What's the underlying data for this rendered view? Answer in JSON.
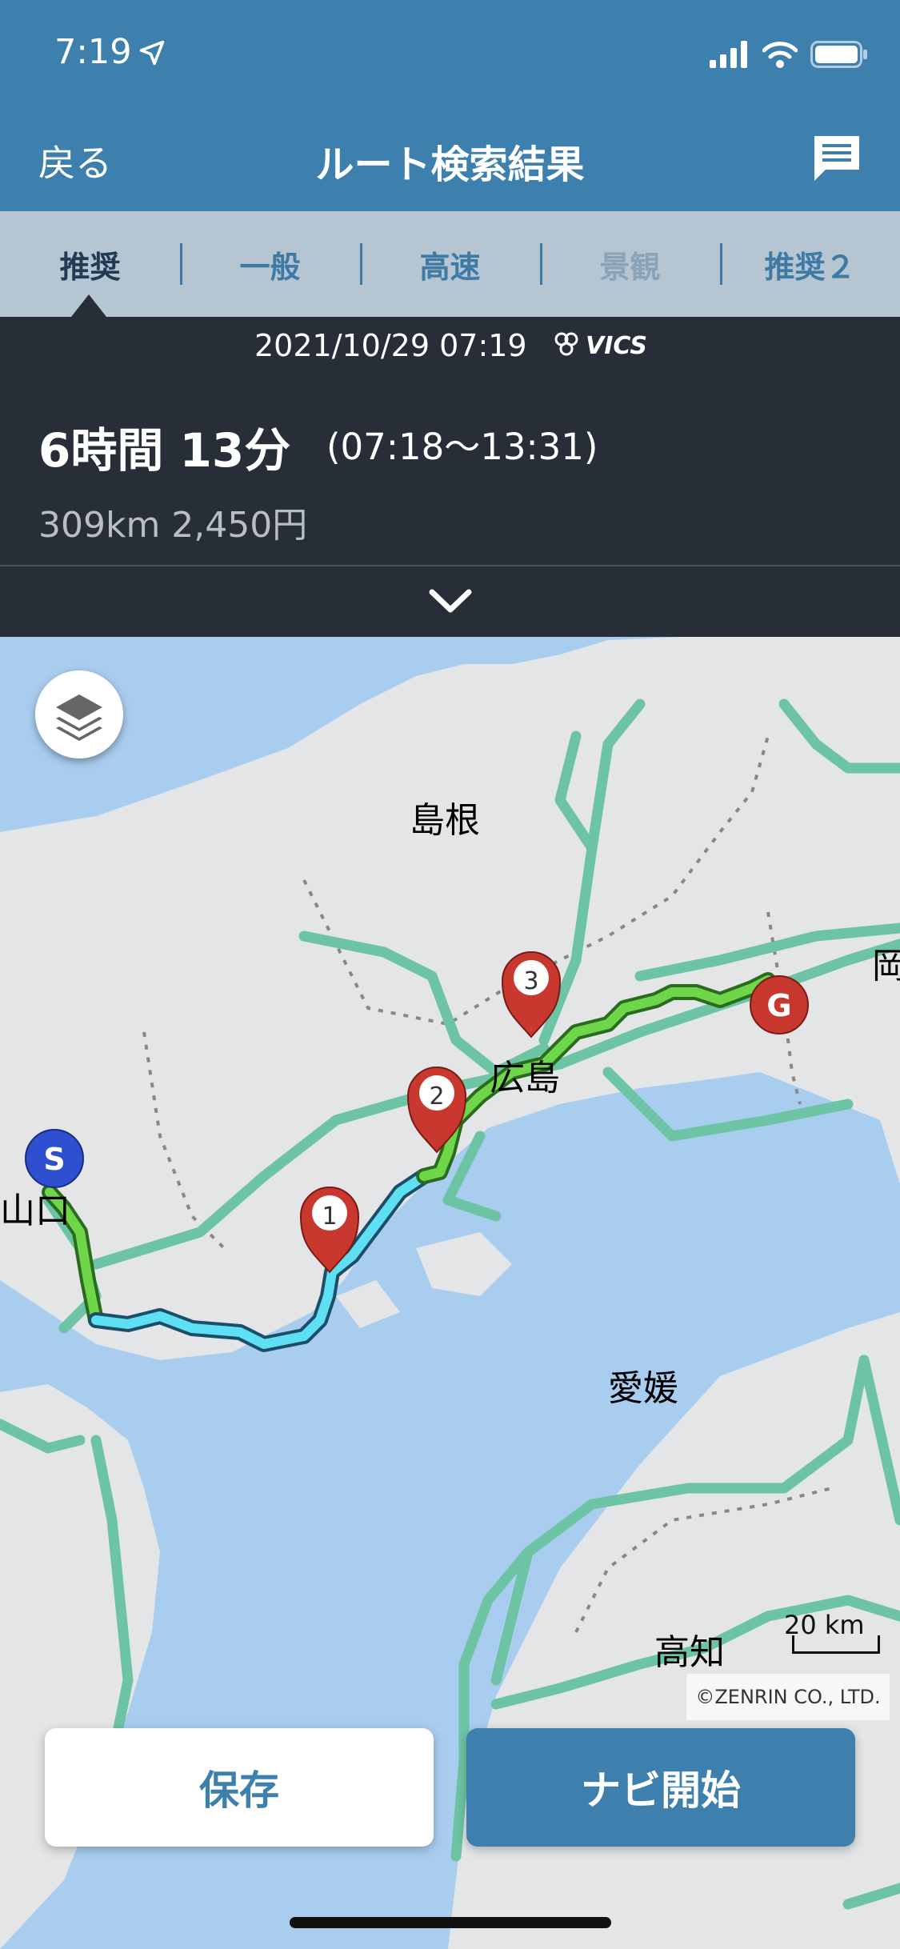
{
  "status_bar": {
    "time": "7:19"
  },
  "header": {
    "back_label": "戻る",
    "title": "ルート検索結果"
  },
  "tabs": [
    {
      "label": "推奨",
      "state": "active"
    },
    {
      "label": "一般",
      "state": "normal"
    },
    {
      "label": "高速",
      "state": "normal"
    },
    {
      "label": "景観",
      "state": "disabled"
    },
    {
      "label": "推奨２",
      "state": "normal"
    }
  ],
  "route_info": {
    "datetime": "2021/10/29 07:19",
    "vics_label": "VICS",
    "duration": "6時間 13分",
    "time_range": "(07:18～13:31)",
    "distance_fare": "309km  2,450円"
  },
  "map": {
    "places": [
      "島根",
      "広島",
      "山口",
      "愛媛",
      "高知",
      "岡"
    ],
    "markers": {
      "start": "S",
      "goal": "G",
      "waypoints": [
        "1",
        "2",
        "3"
      ]
    },
    "scale_label": "20 km",
    "copyright": "©ZENRIN CO., LTD.",
    "colors": {
      "sea": "#a9cdef",
      "land": "#e3e5e7",
      "road": "#6cc4a4",
      "route_green": "#6fd64a",
      "route_blue": "#5ee0f2",
      "marker_red": "#c8382e",
      "start_blue": "#2e4fcf"
    }
  },
  "actions": {
    "save_label": "保存",
    "navi_label": "ナビ開始"
  }
}
